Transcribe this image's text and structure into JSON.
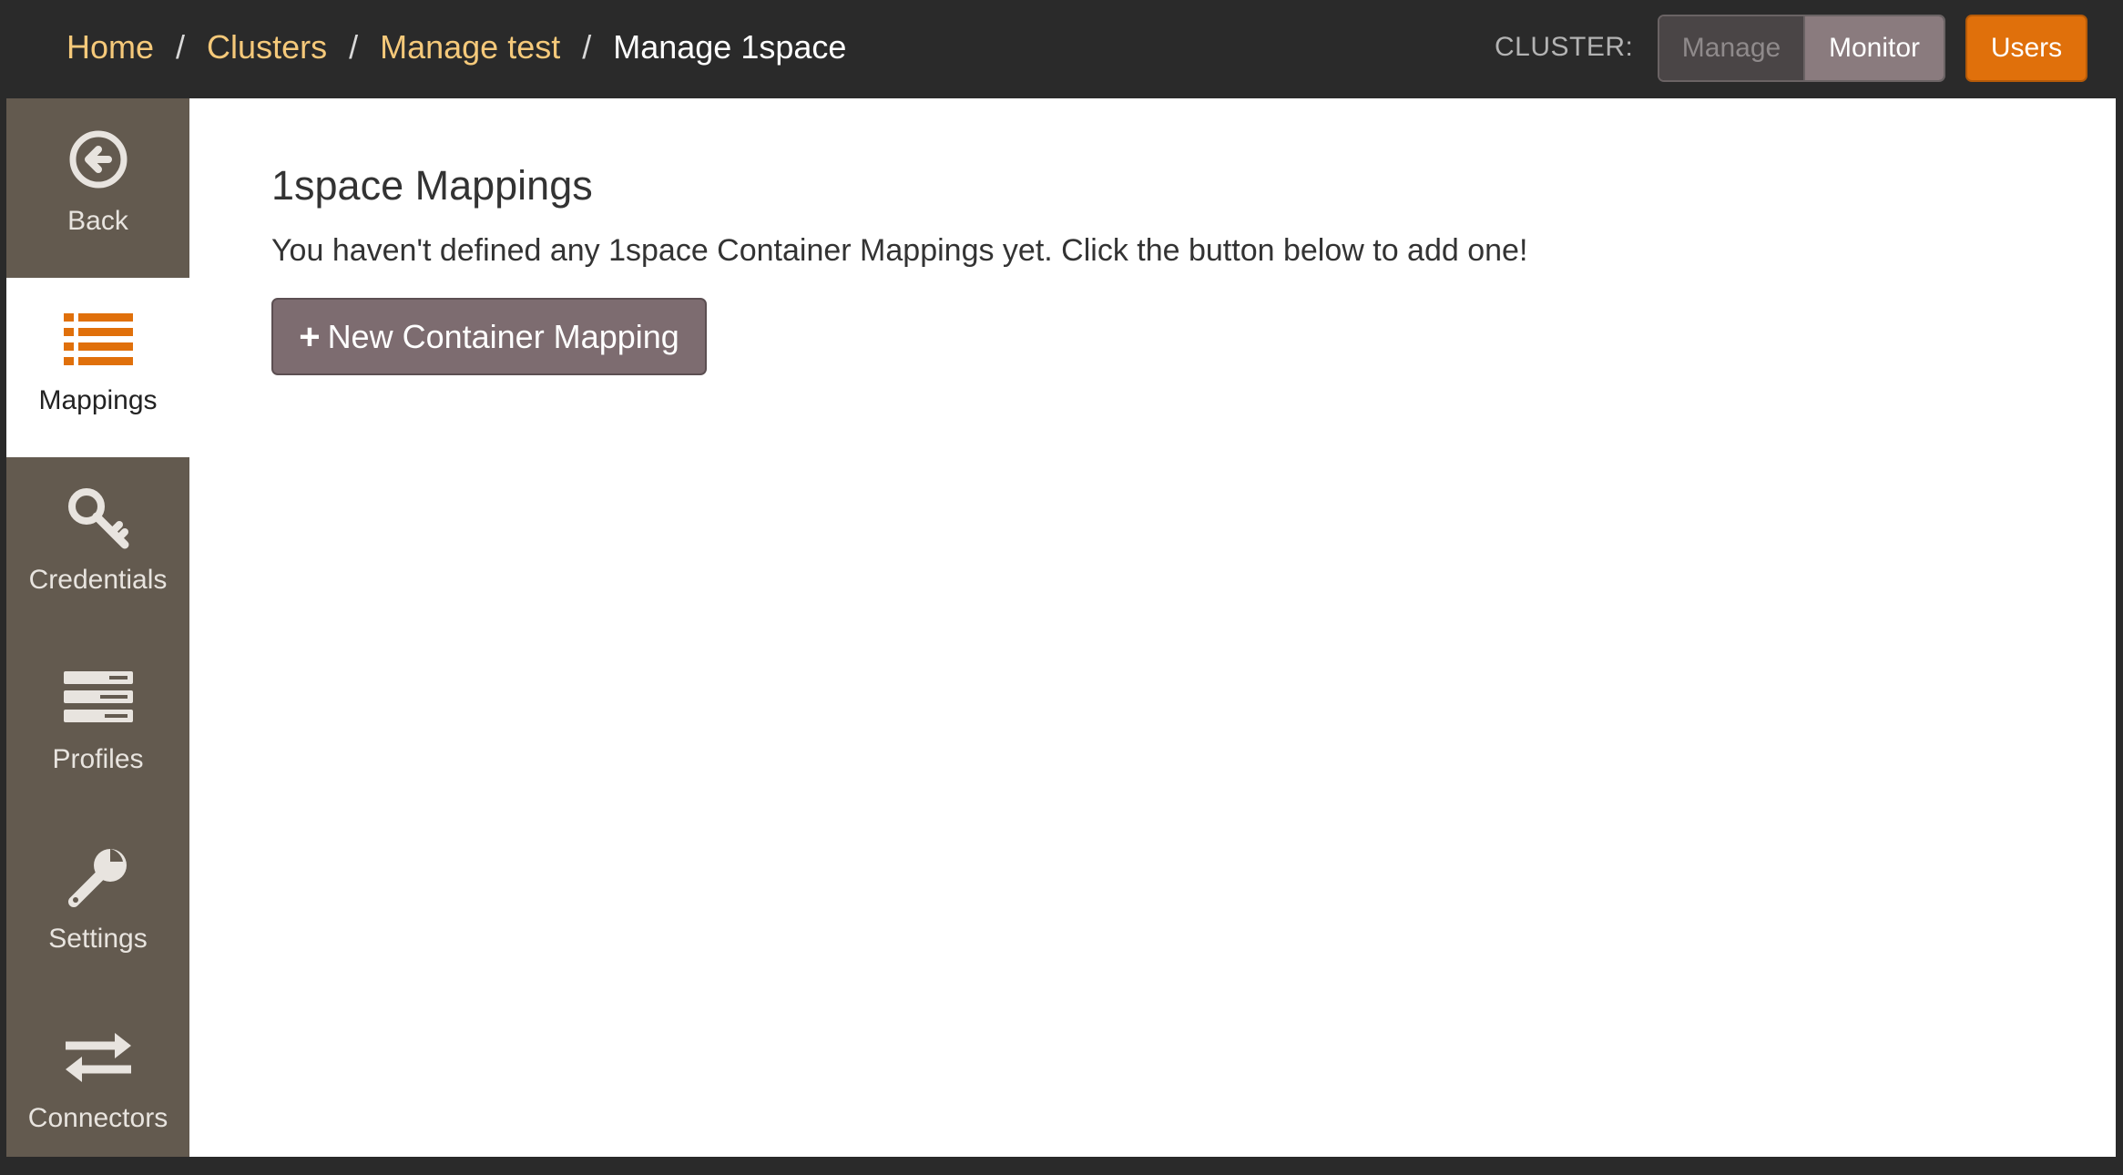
{
  "breadcrumb": {
    "home": "Home",
    "clusters": "Clusters",
    "manage_test": "Manage test",
    "current": "Manage 1space",
    "separator": "/"
  },
  "cluster": {
    "label": "CLUSTER:",
    "manage": "Manage",
    "monitor": "Monitor",
    "active": "Monitor"
  },
  "users_label": "Users",
  "sidebar": {
    "items": [
      {
        "label": "Back",
        "icon": "back-arrow-circle-icon"
      },
      {
        "label": "Mappings",
        "icon": "list-icon",
        "active": true
      },
      {
        "label": "Credentials",
        "icon": "key-icon"
      },
      {
        "label": "Profiles",
        "icon": "server-stack-icon"
      },
      {
        "label": "Settings",
        "icon": "wrench-icon"
      },
      {
        "label": "Connectors",
        "icon": "exchange-arrows-icon"
      }
    ]
  },
  "main": {
    "title": "1space Mappings",
    "description": "You haven't defined any 1space Container Mappings yet. Click the button below to add one!",
    "new_button": "New Container Mapping",
    "new_button_icon": "+"
  },
  "colors": {
    "topbar": "#2a2a2a",
    "link": "#f5c97a",
    "accent_orange": "#e0700b",
    "sidebar": "#635a4f",
    "button": "#7d6c70"
  }
}
